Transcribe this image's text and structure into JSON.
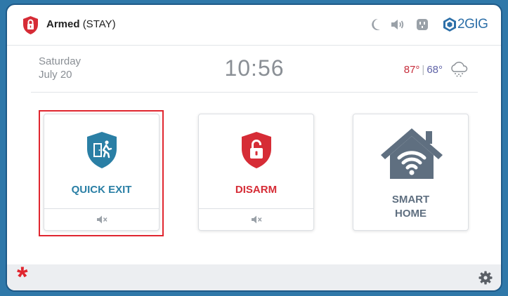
{
  "status": {
    "armed_label": "Armed",
    "mode_label": "(STAY)",
    "icon": "lock-shield-icon"
  },
  "topbar_icons": [
    "moon-icon",
    "speaker-icon",
    "outlet-icon",
    "brand-logo-icon"
  ],
  "brand": "2GIG",
  "info": {
    "day": "Saturday",
    "date": "July 20",
    "time": "10:56",
    "temp_high": "87°",
    "temp_low": "68°",
    "separator": "|",
    "weather_icon": "snow-cloud-icon"
  },
  "tiles": [
    {
      "id": "quick-exit",
      "label": "QUICK EXIT",
      "label_color": "#2a7fa5",
      "icon": "quick-exit-shield-icon",
      "footer_icon": "speaker-muted-icon",
      "selected": true
    },
    {
      "id": "disarm",
      "label": "DISARM",
      "label_color": "#d62c36",
      "icon": "unlock-shield-icon",
      "footer_icon": "speaker-muted-icon"
    },
    {
      "id": "smart-home",
      "label_line1": "SMART",
      "label_line2": "HOME",
      "label_color": "#5f6f80",
      "icon": "house-wifi-icon"
    }
  ],
  "bottombar": {
    "left_icon": "emergency-asterisk-icon",
    "left_label": "*",
    "right_icon": "settings-gear-icon"
  },
  "colors": {
    "accent_red": "#e0262f",
    "frame_blue": "#2f78a9",
    "quick_exit_blue": "#2a7fa5"
  }
}
